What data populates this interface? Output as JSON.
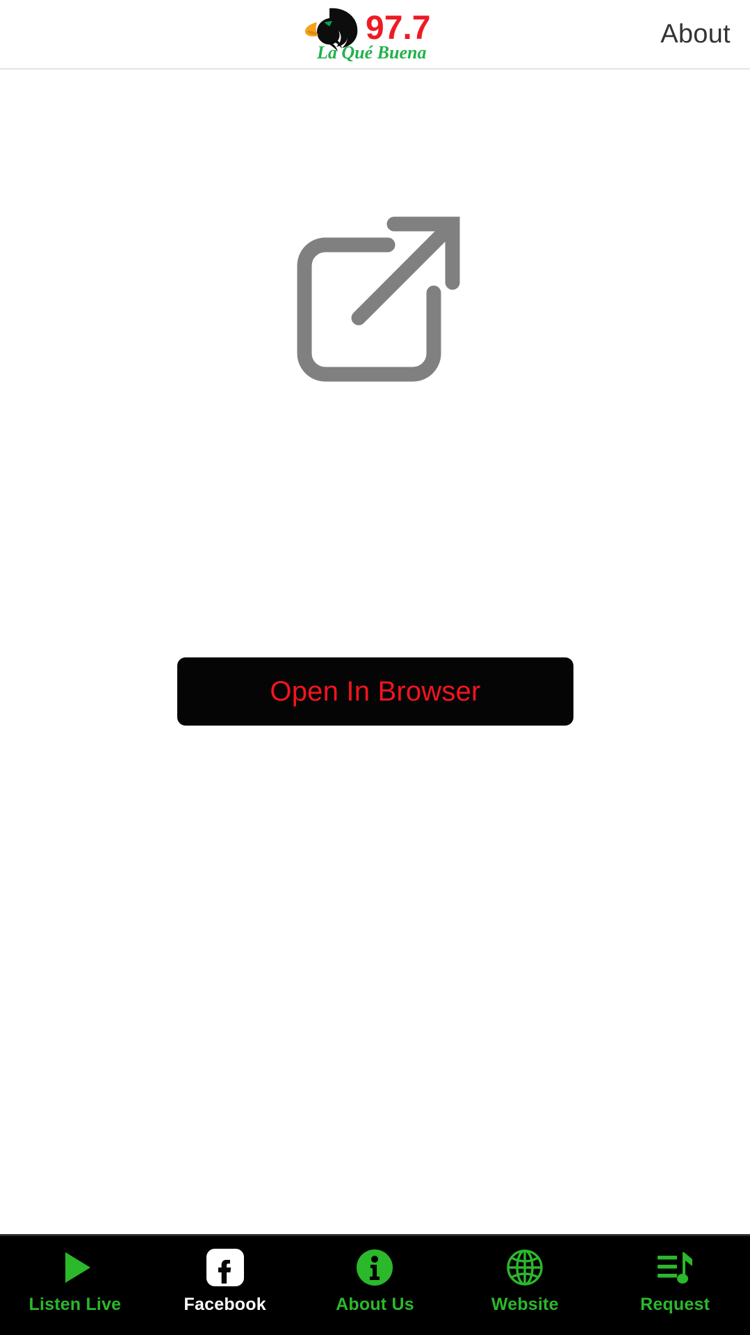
{
  "app": {
    "background": "#ffffff",
    "accent_green": "#2bb82b",
    "accent_red": "#f4141f",
    "icon_gray": "#808080",
    "nav_background": "#000000"
  },
  "header": {
    "logo": {
      "icon": "eagle-head-logo",
      "frequency": "97.7",
      "tagline": "La Qué Buena",
      "frequency_color": "#ed1b24",
      "tagline_color": "#22b14c",
      "beak_color": "#f7a21b",
      "eye_color": "#00a651"
    },
    "about_label": "About"
  },
  "main": {
    "external_link_icon": "external-link-icon",
    "open_in_browser_label": "Open In Browser"
  },
  "tabbar": {
    "items": [
      {
        "label": "Listen Live",
        "icon": "play-icon",
        "label_color": "green"
      },
      {
        "label": "Facebook",
        "icon": "facebook-icon",
        "label_color": "white"
      },
      {
        "label": "About Us",
        "icon": "info-icon",
        "label_color": "green"
      },
      {
        "label": "Website",
        "icon": "globe-icon",
        "label_color": "green"
      },
      {
        "label": "Request",
        "icon": "playlist-note-icon",
        "label_color": "green"
      }
    ]
  }
}
